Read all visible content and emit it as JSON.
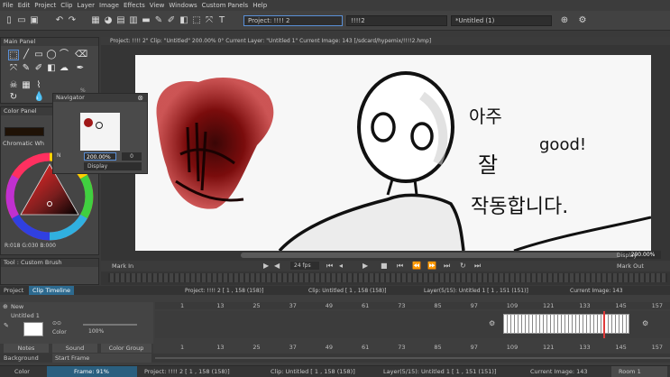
{
  "menu": [
    "File",
    "Edit",
    "Project",
    "Clip",
    "Layer",
    "Image",
    "Effects",
    "View",
    "Windows",
    "Custom Panels",
    "Help"
  ],
  "toolbar": {
    "project_combo": "Project: !!!! 2",
    "clip_combo": "!!!!2",
    "layer_combo": "*Untitled (1)"
  },
  "main_panel": {
    "title": "Main Panel",
    "pct": "% 100%"
  },
  "color_panel": {
    "title": "Color Panel",
    "wheel_label": "Chromatic Wh",
    "rgb": "R:018 G:030 B:000"
  },
  "navigator": {
    "title": "Navigator",
    "zoom": "200.00%",
    "angle": "0",
    "display": "Display"
  },
  "tool_panel": {
    "title": "Tool : Custom Brush"
  },
  "viewer": {
    "info": "Project: !!!! 2\"  Clip: \"Untitled\"  200.00%  0°  Current Layer: \"Untitled 1\"  Current Image: 143  [/sdcard/hypemix/!!!!2.hmp]",
    "zoom": "200.00%",
    "display": "Display",
    "mark_in": "Mark In",
    "mark_out": "Mark Out",
    "fps": "24 fps"
  },
  "canvas_text": {
    "korean_1": "아주",
    "english": "good!",
    "korean_2": "잘",
    "korean_3": "작동합니다."
  },
  "tabs": {
    "project": "Project",
    "clip_timeline": "Clip Timeline"
  },
  "timeline": {
    "header_project": "Project: !!!! 2 [ 1 , 158 (158)]",
    "header_clip": "Clip: Untitled [ 1 , 158 (158)]",
    "header_layer": "Layer(5/15): Untitled 1 [ 1 , 151 (151)]",
    "header_image": "Current Image: 143",
    "new_label": "New",
    "layer_name": "Untitled 1",
    "color_label": "Color",
    "opacity_value": "100%",
    "notes": "Notes",
    "sound": "Sound",
    "color_group": "Color Group",
    "background": "Background",
    "start_frame": "Start Frame",
    "ticks": [
      "1",
      "13",
      "25",
      "37",
      "49",
      "61",
      "73",
      "85",
      "97",
      "109",
      "121",
      "133",
      "145",
      "157"
    ],
    "current_frame": "143"
  },
  "status": {
    "color": "Color",
    "frame_pct": "Frame: 91%",
    "project": "Project: !!!! 2 [ 1 , 158 (158)]",
    "clip": "Clip: Untitled [ 1 , 158 (158)]",
    "layer": "Layer(5/15): Untitled 1 [ 1 , 151 (151)]",
    "image": "Current Image: 143",
    "zoom": "Room 1"
  },
  "colors": {
    "accent": "#5a8fd6",
    "playhead": "#e03a3a",
    "panel": "#454545"
  }
}
